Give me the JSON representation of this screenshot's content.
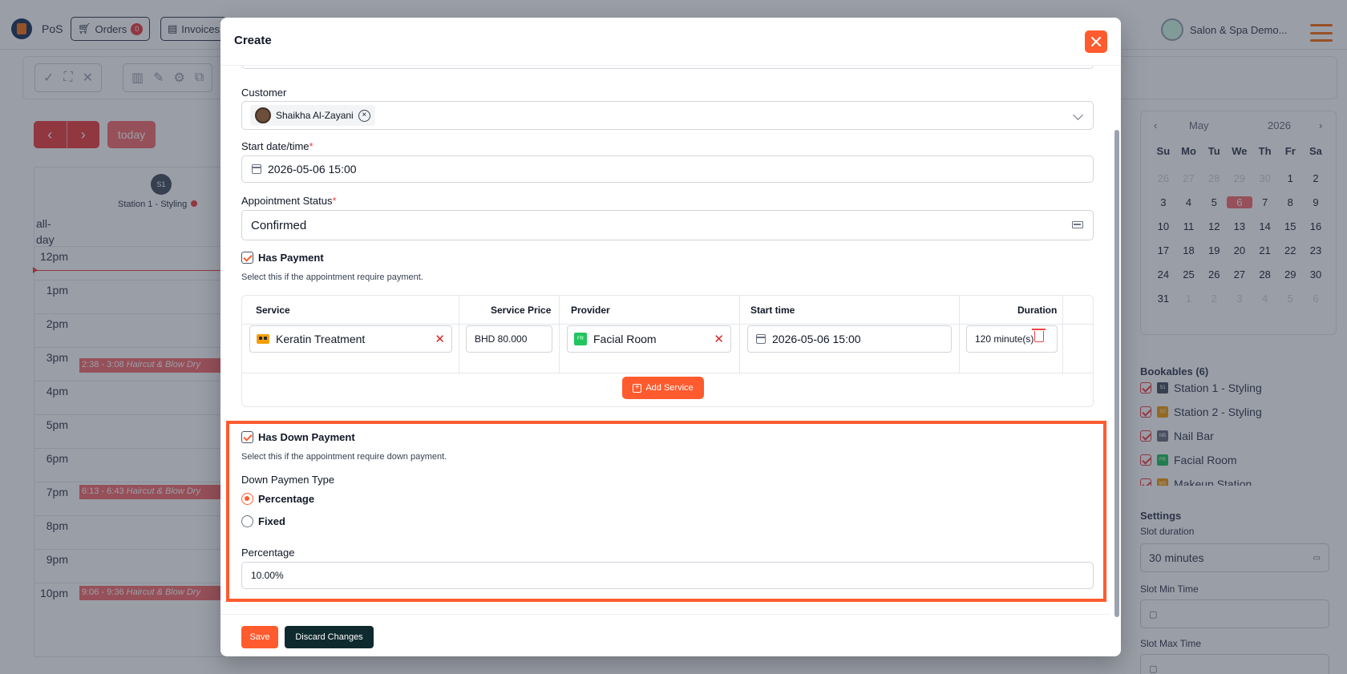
{
  "app": {
    "pos_label": "PoS",
    "orders_label": "Orders",
    "orders_count": "0",
    "invoices_label": "Invoices",
    "user_name": "Salon & Spa Demo..."
  },
  "calendar": {
    "today_label": "today",
    "station_abbr": "S1",
    "station_name": "Station 1 - Styling",
    "allday_label": "all-day",
    "hours": [
      "12pm",
      "1pm",
      "2pm",
      "3pm",
      "4pm",
      "5pm",
      "6pm",
      "7pm",
      "8pm",
      "9pm",
      "10pm"
    ],
    "events": [
      {
        "time": "2:38 - 3:08",
        "title": "Haircut & Blow Dry"
      },
      {
        "time": "6:13 - 6:43",
        "title": "Haircut & Blow Dry"
      },
      {
        "time": "9:06 - 9:36",
        "title": "Haircut & Blow Dry"
      }
    ]
  },
  "mini_calendar": {
    "month": "May",
    "year": "2026",
    "weekdays": [
      "Su",
      "Mo",
      "Tu",
      "We",
      "Th",
      "Fr",
      "Sa"
    ],
    "weeks": [
      [
        "26",
        "27",
        "28",
        "29",
        "30",
        "1",
        "2"
      ],
      [
        "3",
        "4",
        "5",
        "6",
        "7",
        "8",
        "9"
      ],
      [
        "10",
        "11",
        "12",
        "13",
        "14",
        "15",
        "16"
      ],
      [
        "17",
        "18",
        "19",
        "20",
        "21",
        "22",
        "23"
      ],
      [
        "24",
        "25",
        "26",
        "27",
        "28",
        "29",
        "30"
      ],
      [
        "31",
        "1",
        "2",
        "3",
        "4",
        "5",
        "6"
      ]
    ]
  },
  "bookables": {
    "title": "Bookables (6)",
    "items": [
      {
        "abbr": "S1",
        "name": "Station 1 - Styling",
        "color": "#4b5563"
      },
      {
        "abbr": "S2",
        "name": "Station 2 - Styling",
        "color": "#f59e0b"
      },
      {
        "abbr": "NB",
        "name": "Nail Bar",
        "color": "#6b7280"
      },
      {
        "abbr": "FR",
        "name": "Facial Room",
        "color": "#22c55e"
      },
      {
        "abbr": "MS",
        "name": "Makeup Station",
        "color": "#f59e0b"
      }
    ]
  },
  "settings": {
    "title": "Settings",
    "slot_duration_label": "Slot duration",
    "slot_duration_value": "30 minutes",
    "slot_min_label": "Slot Min Time",
    "slot_max_label": "Slot Max Time"
  },
  "modal": {
    "title": "Create",
    "customer_label": "Customer",
    "customer_name": "Shaikha Al-Zayani",
    "start_label": "Start date/time",
    "start_value": "2026-05-06 15:00",
    "status_label": "Appointment Status",
    "status_value": "Confirmed",
    "has_payment_label": "Has Payment",
    "has_payment_help": "Select this if the appointment require payment.",
    "services": {
      "headers": {
        "service": "Service",
        "price": "Service Price",
        "provider": "Provider",
        "start": "Start time",
        "duration": "Duration"
      },
      "row": {
        "service": "Keratin Treatment",
        "price": "BHD 80.000",
        "provider_abbr": "FR",
        "provider": "Facial Room",
        "start": "2026-05-06 15:00",
        "duration": "120 minute(s)"
      },
      "add_label": "Add Service"
    },
    "has_down_label": "Has Down Payment",
    "has_down_help": "Select this if the appointment require down payment.",
    "down_type_label": "Down Paymen Type",
    "down_type_options": [
      "Percentage",
      "Fixed"
    ],
    "percentage_label": "Percentage",
    "percentage_value": "10.00%",
    "save_label": "Save",
    "discard_label": "Discard Changes"
  }
}
